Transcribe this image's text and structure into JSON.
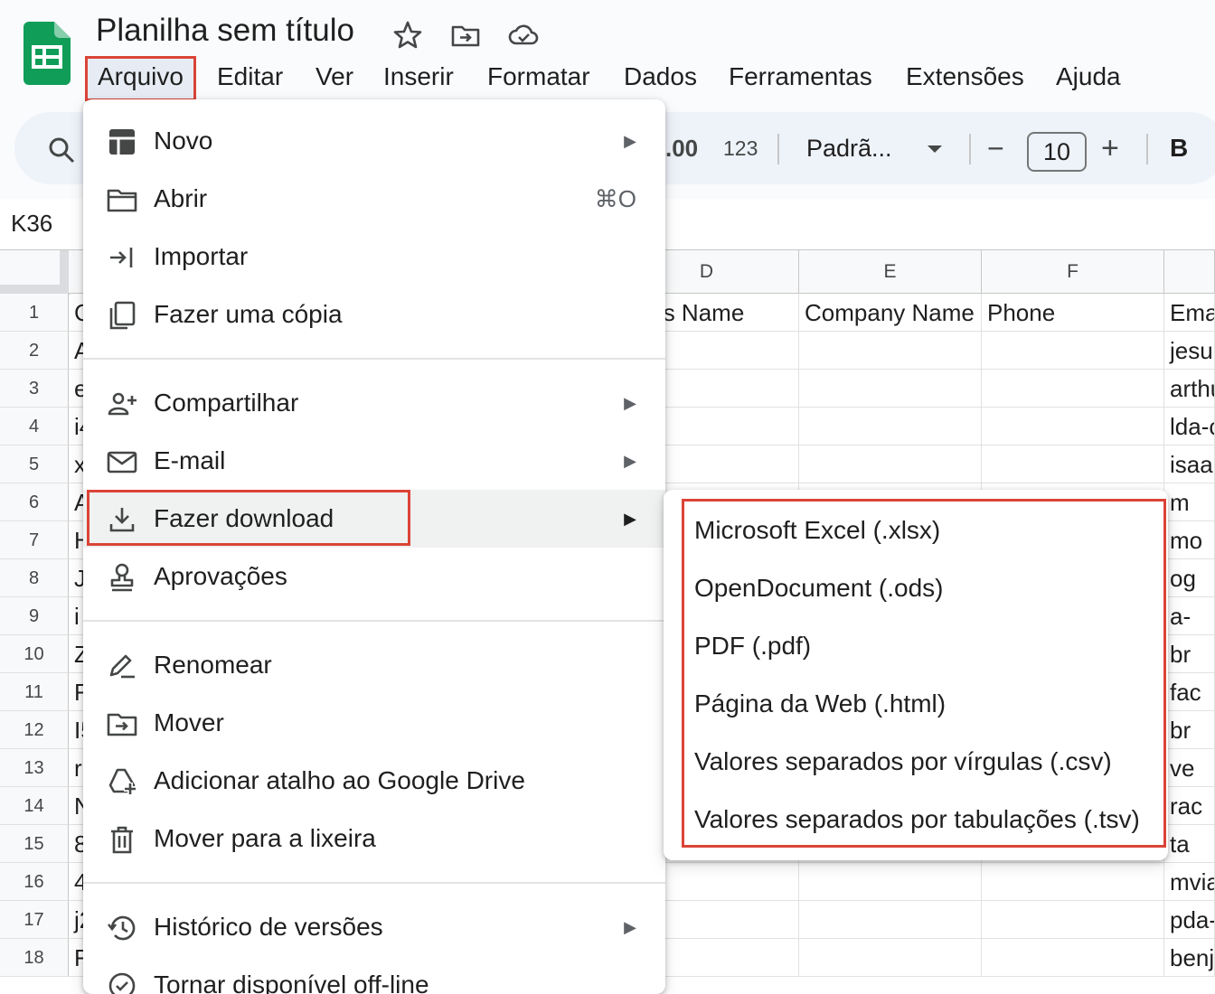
{
  "app": {
    "doc_title": "Planilha sem título",
    "accent_green": "#0f9d58",
    "highlight_red": "#db4437"
  },
  "menubar": [
    "Arquivo",
    "Editar",
    "Ver",
    "Inserir",
    "Formatar",
    "Dados",
    "Ferramentas",
    "Extensões",
    "Ajuda"
  ],
  "toolbar": {
    "decimal_increase": ".00",
    "number_format": "123",
    "font_name": "Padrã...",
    "font_size": "10",
    "minus": "−",
    "plus": "+",
    "bold": "B"
  },
  "formula_bar": {
    "cell_ref": "K36"
  },
  "grid": {
    "columns": [
      "D",
      "E",
      "F"
    ],
    "rows": [
      "1",
      "2",
      "3",
      "4",
      "5",
      "6",
      "7",
      "8",
      "9",
      "10",
      "11",
      "12",
      "13",
      "14",
      "15",
      "16",
      "17",
      "18"
    ],
    "header_row": {
      "d": "iness Name",
      "e": "Company Name",
      "f": "Phone",
      "g": "Ema"
    },
    "col_c_partial": [
      "C",
      "A",
      "e",
      "i4",
      "x",
      "A",
      "H",
      "J",
      "i",
      "Z",
      "F",
      "I5",
      "r",
      "N",
      "8",
      "4",
      "j2",
      "F"
    ],
    "col_g_partial": [
      "Ema",
      "jesu",
      "arthu",
      "lda-c",
      "isaa",
      "m",
      "mo",
      "og",
      "a-",
      "br",
      "fac",
      "br",
      "ve",
      "rac",
      "ta",
      "mvia",
      "pda-",
      "benj"
    ]
  },
  "file_menu": {
    "items": {
      "novo": "Novo",
      "abrir": "Abrir",
      "abrir_shortcut": "⌘O",
      "importar": "Importar",
      "copia": "Fazer uma cópia",
      "compartilhar": "Compartilhar",
      "email": "E-mail",
      "download": "Fazer download",
      "aprovacoes": "Aprovações",
      "renomear": "Renomear",
      "mover": "Mover",
      "atalho": "Adicionar atalho ao Google Drive",
      "lixeira": "Mover para a lixeira",
      "historico": "Histórico de versões",
      "offline": "Tornar disponível off-line"
    },
    "arrow_glyph": "▶"
  },
  "download_submenu": [
    "Microsoft Excel (.xlsx)",
    "OpenDocument (.ods)",
    "PDF (.pdf)",
    "Página da Web (.html)",
    "Valores separados por vírgulas (.csv)",
    "Valores separados por tabulações (.tsv)"
  ]
}
